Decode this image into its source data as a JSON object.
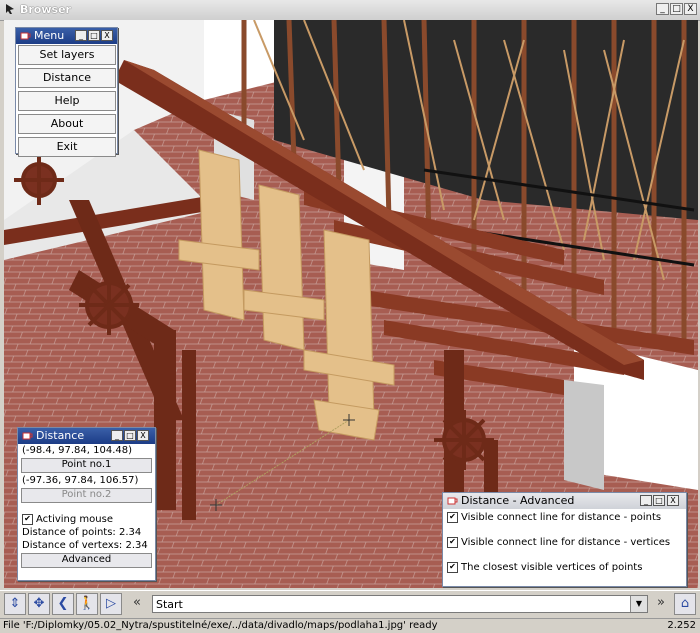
{
  "window": {
    "title": "Browser",
    "minimize": "_",
    "maximize": "□",
    "close": "X"
  },
  "menu_frame": {
    "title": "Menu",
    "buttons": [
      "Set layers",
      "Distance",
      "Help",
      "About",
      "Exit"
    ]
  },
  "distance_frame": {
    "title": "Distance",
    "point1_coords": "(-98.4, 97.84, 104.48)",
    "point1_button": "Point no.1",
    "point2_coords": "(-97.36, 97.84, 106.57)",
    "point2_button": "Point no.2",
    "activing_mouse_label": "Activing mouse",
    "activing_mouse_checked": true,
    "distance_points": "Distance of points: 2.34",
    "distance_vertexs": "Distance of vertexs: 2.34",
    "advanced_button": "Advanced"
  },
  "advanced_frame": {
    "title": "Distance - Advanced",
    "options": [
      {
        "label": "Visible connect line for distance - points",
        "checked": true
      },
      {
        "label": "Visible connect line for distance - vertices",
        "checked": true
      },
      {
        "label": "The closest visible vertices of points",
        "checked": true
      }
    ]
  },
  "toolbar": {
    "combo_value": "Start",
    "icons": [
      "up-down-arrow-icon",
      "move-cross-icon",
      "rotate-left-icon",
      "walk-person-icon",
      "fly-icon",
      "back-icon",
      "forward-icon",
      "home-icon"
    ]
  },
  "status": {
    "text": "File 'F:/Diplomky/05.02_Nytra/spustitelné/exe/../data/divadlo/maps/podlaha1.jpg' ready",
    "zoom": "2.252"
  },
  "colors": {
    "floor": "#a65c50",
    "wood_dark": "#7a2e1c",
    "wood_light": "#e8c896",
    "frame_title": "#1c3c86",
    "inactive_title": "#d0d3da"
  }
}
